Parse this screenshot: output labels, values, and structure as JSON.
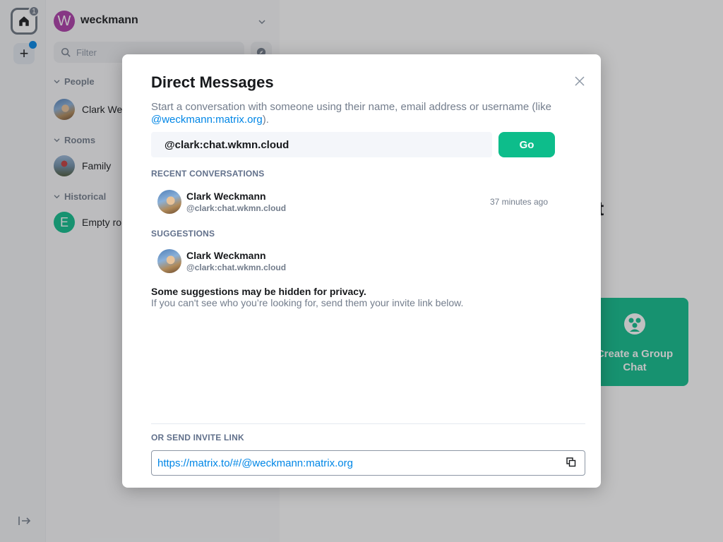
{
  "spaces": {
    "home_badge": "1"
  },
  "account": {
    "avatar_letter": "W",
    "name": "weckmann"
  },
  "filter": {
    "placeholder": "Filter"
  },
  "sections": {
    "people": "People",
    "rooms": "Rooms",
    "historical": "Historical"
  },
  "rooms": {
    "people_item": "Clark We",
    "rooms_item": "Family",
    "historical_letter": "E",
    "historical_item": "Empty ro"
  },
  "background": {
    "title_fragment": "t",
    "group_card_label": "Create a Group Chat"
  },
  "dialog": {
    "title": "Direct Messages",
    "description": "Start a conversation with someone using their name, email address or username (like ",
    "description_link": "@weckmann:matrix.org",
    "description_end": ").",
    "input_value": "@clark:chat.wkmn.cloud",
    "go_label": "Go",
    "recent_header": "RECENT CONVERSATIONS",
    "recent": {
      "name": "Clark Weckmann",
      "mxid": "@clark:chat.wkmn.cloud",
      "time": "37 minutes ago"
    },
    "suggestions_header": "SUGGESTIONS",
    "suggestion": {
      "name": "Clark Weckmann",
      "mxid": "@clark:chat.wkmn.cloud"
    },
    "privacy_heading": "Some suggestions may be hidden for privacy.",
    "privacy_text": "If you can't see who you’re looking for, send them your invite link below.",
    "invite_header": "OR SEND INVITE LINK",
    "invite_link": "https://matrix.to/#/@weckmann:matrix.org"
  },
  "colors": {
    "accent": "#0dbd8b",
    "link": "#0086e6",
    "account_avatar": "#ac3ba8",
    "historical_avatar": "#0dbd8b"
  }
}
